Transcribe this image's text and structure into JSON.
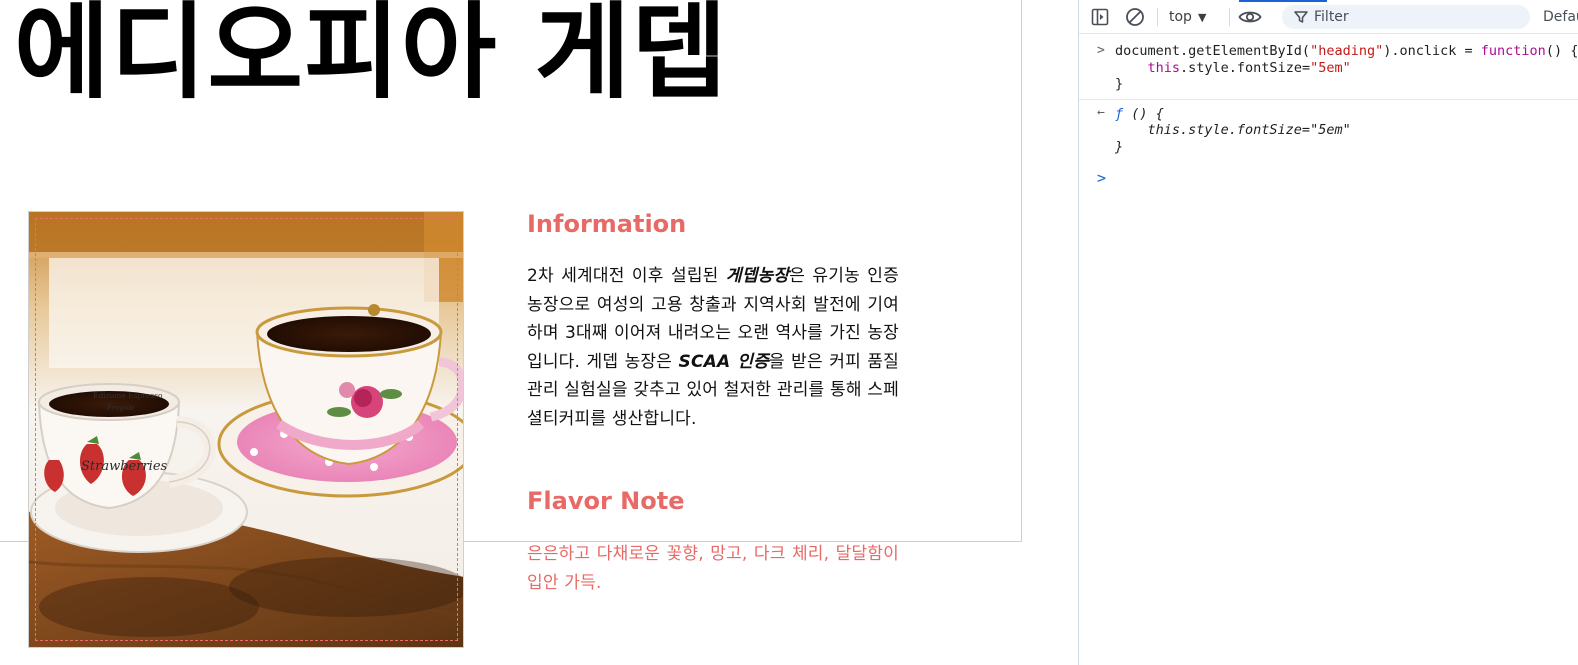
{
  "page": {
    "heading": "에디오피아 게뎁",
    "image_alt": "두 잔의 커피 잔",
    "info_title": "Information",
    "info_paragraph": {
      "p1": "2차 세계대전 이후 설립된 ",
      "b1": "게뎁농장",
      "p2": "은 유기농 인증 농장으로 여성의 고용 창출과 지역사회 발전에 기여하며 3대째 이어져 내려오는 오랜 역사를 가진 농장입니다. 게뎁 농장은 ",
      "b2": "SCAA 인증",
      "p3": "을 받은 커피 품질관리 실험실을 갖추고 있어 철저한 관리를 통해 스페셜티커피를 생산합니다."
    },
    "flavor_title": "Flavor Note",
    "flavor_text": "은은하고 다채로운 꽃향, 망고, 다크 체리, 달달함이 입안 가득.",
    "cup_label_1": "Edizione Espresso",
    "cup_label_2": "Fragole",
    "cup_label_3": "Strawberries",
    "colors": {
      "accent": "#e86a66",
      "outline_dashed": "#f06a6a"
    }
  },
  "devtools": {
    "toolbar": {
      "context": "top",
      "filter_placeholder": "Filter",
      "levels_label": "Default levels"
    },
    "console": {
      "input_gutter": ">",
      "result_gutter": "←",
      "prompt_gutter": ">",
      "input": {
        "l1_a": "document.getElementById(",
        "l1_str": "\"heading\"",
        "l1_b": ").onclick = ",
        "l1_kw": "function",
        "l1_c": "() {",
        "l2_indent": "    ",
        "l2_kw": "this",
        "l2_b": ".style.fontSize=",
        "l2_str": "\"5em\"",
        "l3": "}"
      },
      "result": {
        "f_label": "ƒ",
        "r1_rest": " () {",
        "r2": "    this.style.fontSize=\"5em\"",
        "r3": "}"
      }
    }
  }
}
